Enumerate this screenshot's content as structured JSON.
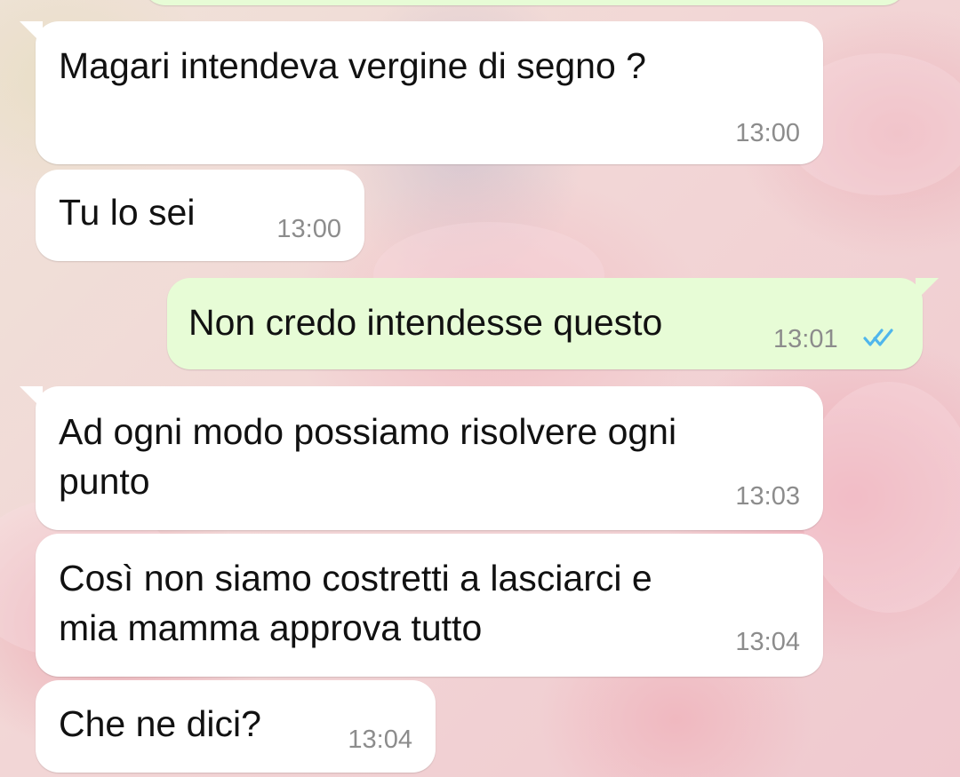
{
  "chat": {
    "messages": [
      {
        "direction": "incoming",
        "text": "Magari intendeva vergine di segno ?",
        "time": "13:00"
      },
      {
        "direction": "incoming",
        "text": "Tu lo sei",
        "time": "13:00"
      },
      {
        "direction": "outgoing",
        "text": "Non credo intendesse questo",
        "time": "13:01",
        "status": "read",
        "status_icon": "double-check-icon",
        "status_color": "#4fb6ec"
      },
      {
        "direction": "incoming",
        "text": "Ad ogni modo possiamo risolvere ogni\npunto",
        "time": "13:03"
      },
      {
        "direction": "incoming",
        "text": "Così non siamo costretti a lasciarci e\nmia mamma approva tutto",
        "time": "13:04"
      },
      {
        "direction": "incoming",
        "text": "Che ne dici?",
        "time": "13:04"
      }
    ]
  },
  "colors": {
    "incoming_bubble": "#ffffff",
    "outgoing_bubble": "#e7fcd6",
    "time_text": "#8c8c8c",
    "read_ticks": "#4fb6ec"
  }
}
